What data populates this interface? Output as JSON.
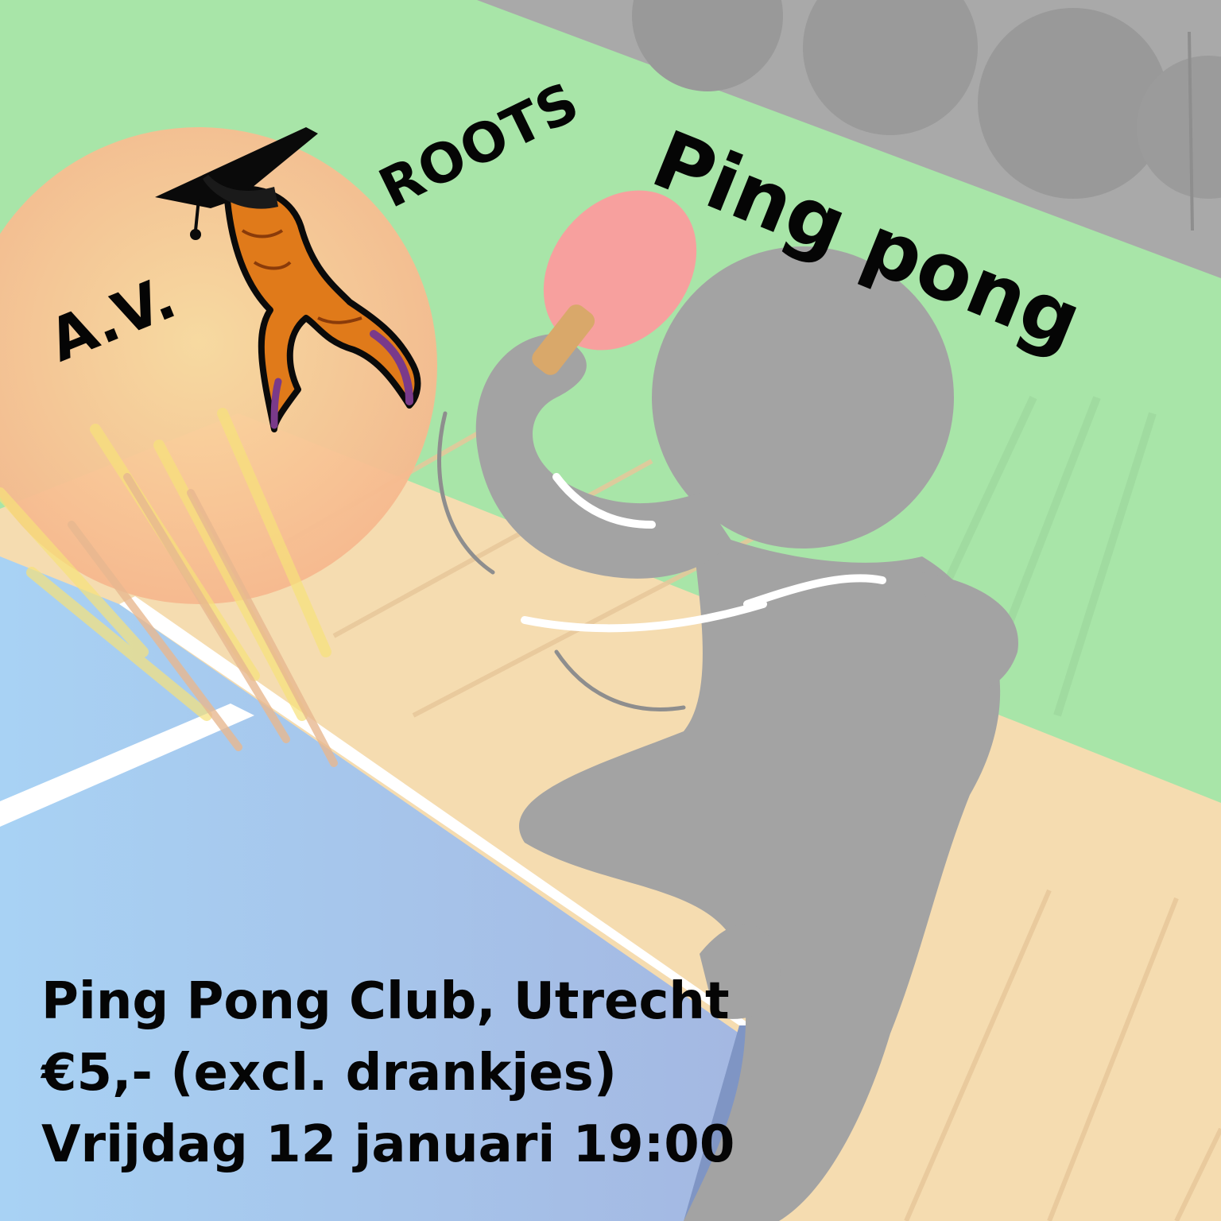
{
  "logo": {
    "prefix": "A.V.",
    "name": "ROOTS",
    "icon": "carrot-with-graduation-cap-icon"
  },
  "headline": "Ping pong",
  "details": {
    "venue": "Ping Pong Club, Utrecht",
    "price": "€5,- (excl. drankjes)",
    "datetime": "Vrijdag 12 januari 19:00"
  },
  "colors": {
    "wall_green": "#a8e5a8",
    "floor_beige": "#f5dcb0",
    "table_blue": "#9ec8ee",
    "silhouette_grey": "#a3a3a3",
    "paddle_red": "#f7a09e",
    "carrot_orange": "#e07a1a",
    "ball_orange": "#f6bb90",
    "text": "#050505"
  }
}
